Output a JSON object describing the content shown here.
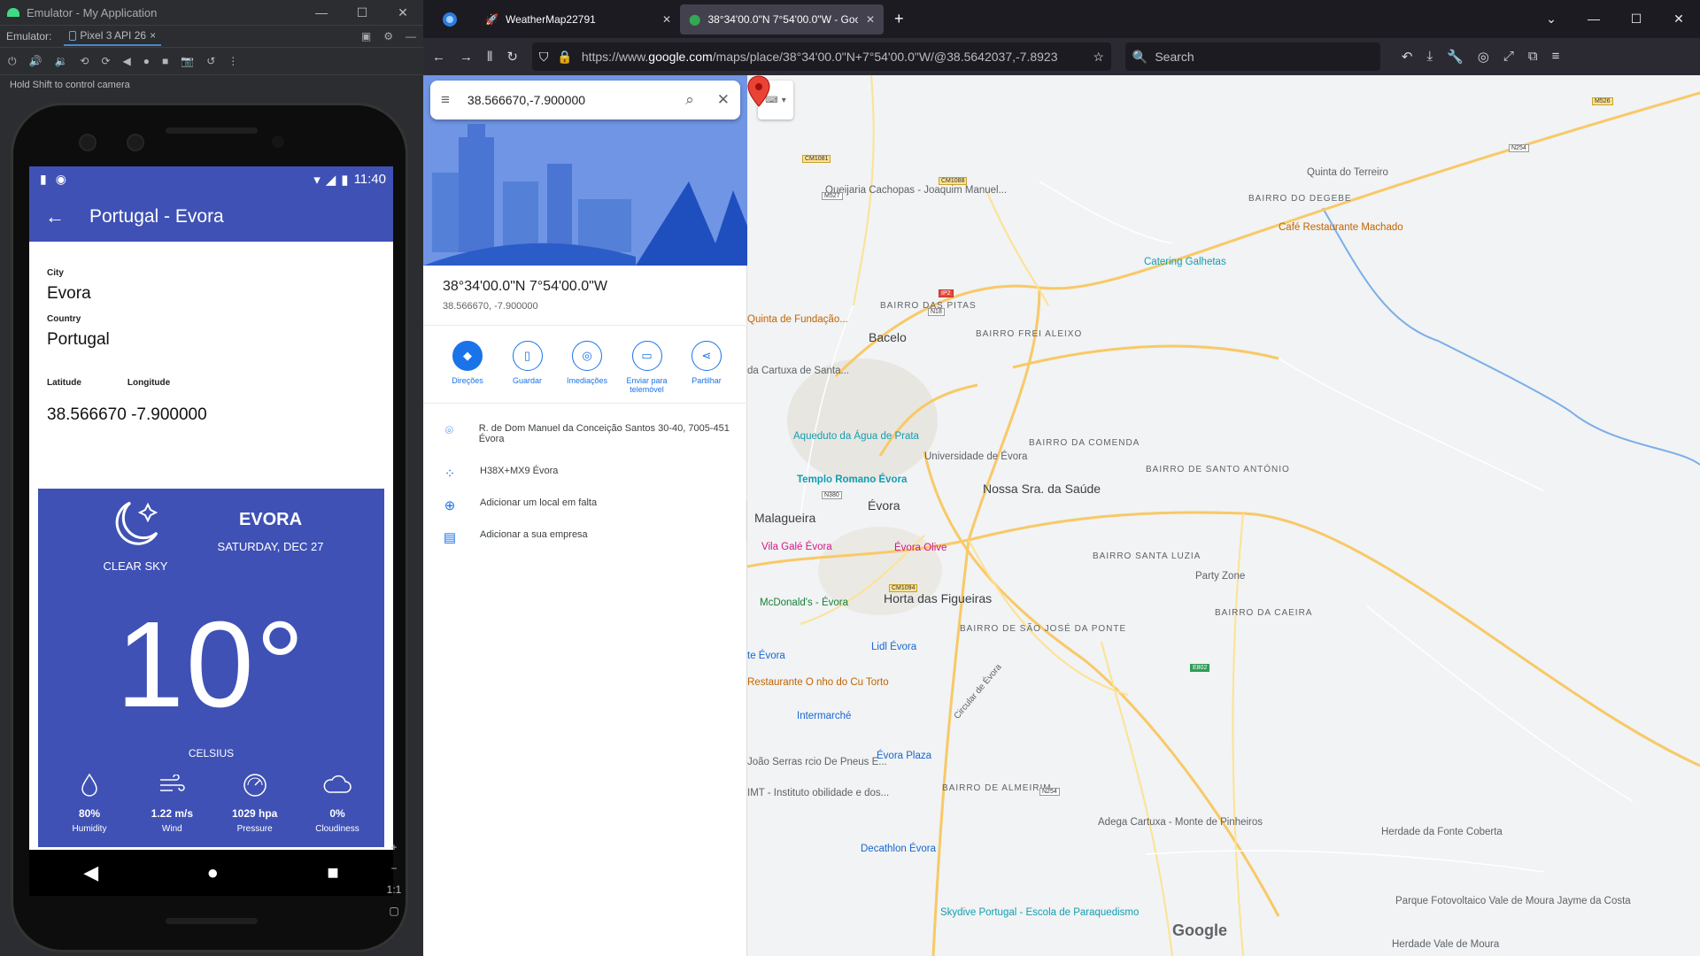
{
  "emulator": {
    "window_title": "Emulator - My Application",
    "tab_label": "Emulator:",
    "device": "Pixel 3 API 26",
    "hint": "Hold Shift to control camera",
    "side_controls": [
      "+",
      "−",
      "1:1",
      "▢"
    ]
  },
  "app": {
    "status_time": "11:40",
    "toolbar_title": "Portugal - Evora",
    "city_label": "City",
    "city": "Evora",
    "country_label": "Country",
    "country": "Portugal",
    "latitude_label": "Latitude",
    "longitude_label": "Longitude",
    "coords": "38.566670 -7.900000",
    "weather": {
      "condition": "CLEAR SKY",
      "city": "EVORA",
      "date": "SATURDAY, DEC 27",
      "temperature": "10°",
      "unit": "CELSIUS",
      "stats": [
        {
          "value": "80%",
          "label": "Humidity",
          "icon": "drop-icon"
        },
        {
          "value": "1.22 m/s",
          "label": "Wind",
          "icon": "wind-icon"
        },
        {
          "value": "1029 hpa",
          "label": "Pressure",
          "icon": "gauge-icon"
        },
        {
          "value": "0%",
          "label": "Cloudiness",
          "icon": "cloud-icon"
        }
      ]
    },
    "colors": {
      "primary": "#3f51b5"
    }
  },
  "browser": {
    "tabs": [
      {
        "title": "WeatherMap22791"
      },
      {
        "title": "38°34'00.0\"N 7°54'00.0\"W - Goo"
      }
    ],
    "url_prefix": "https://www.",
    "url_domain": "google.com",
    "url_rest": "/maps/place/38°34'00.0\"N+7°54'00.0\"W/@38.5642037,-7.8923",
    "search_placeholder": "Search"
  },
  "maps": {
    "search_query": "38.566670,-7.900000",
    "place_title": "38°34'00.0\"N 7°54'00.0\"W",
    "place_sub": "38.566670, -7.900000",
    "actions": [
      "Direções",
      "Guardar",
      "Imediações",
      "Enviar para telemóvel",
      "Partilhar"
    ],
    "rows": [
      "R. de Dom Manuel da Conceição Santos 30-40, 7005-451 Évora",
      "H38X+MX9 Évora",
      "Adicionar um local em falta",
      "Adicionar a sua empresa"
    ],
    "labels": {
      "quinta_terreiro": "Quinta do Terreiro",
      "bairro_degebe": "BAIRRO DO DEGEBE",
      "cafe": "Café Restaurante Machado",
      "catering": "Catering Galhetas",
      "queijaria": "Queijaria Cachopas - Joaquim Manuel...",
      "quinta_fundacao": "Quinta de Fundação...",
      "bacelo": "Bacelo",
      "bairro_pitas": "BAIRRO DAS PITAS",
      "bairro_frei": "BAIRRO FREI ALEIXO",
      "cartuxa": "da Cartuxa de Santa...",
      "aqueduto": "Aqueduto da Água de Prata",
      "universidade": "Universidade de Évora",
      "bairro_comenda": "BAIRRO DA COMENDA",
      "bairro_antonio": "BAIRRO DE SANTO ANTÓNIO",
      "templo": "Templo Romano Évora",
      "nossa_sra": "Nossa Sra. da Saúde",
      "malagueira": "Malagueira",
      "evora": "Évora",
      "vila_gale": "Vila Galé Évora",
      "evora_olive": "Évora Olive",
      "bairro_luzia": "BAIRRO SANTA LUZIA",
      "party_zone": "Party Zone",
      "mcdonalds": "McDonald's - Évora",
      "horta": "Horta das Figueiras",
      "bairro_caeira": "BAIRRO DA CAEIRA",
      "lidl": "Lidl Évora",
      "te_evora": "te Évora",
      "bairro_sao_jose": "BAIRRO DE SÃO JOSÉ DA PONTE",
      "restaurante_torto": "Restaurante O nho do Cu Torto",
      "intermarche": "Intermarché",
      "circular": "Circular de Évora",
      "evora_plaza": "Évora Plaza",
      "joao_serras": "João Serras rcio De Pneus E...",
      "imt": "IMT - Instituto obilidade e dos...",
      "bairro_almeirim": "BAIRRO DE ALMEIRIM",
      "adega": "Adega Cartuxa - Monte de Pinheiros",
      "herdade_fonte": "Herdade da Fonte Coberta",
      "decathlon": "Decathlon Évora",
      "skydive": "Skydive Portugal - Escola de Paraquedismo",
      "parque": "Parque Fotovoltaico Vale de Moura Jayme da Costa",
      "herdade_vale": "Herdade Vale de Moura",
      "google": "Google"
    },
    "road_shields": [
      "M526",
      "N254",
      "CM1081",
      "M527",
      "CM1088",
      "N18",
      "IP2",
      "N380",
      "CM1094",
      "E802",
      "N254"
    ]
  }
}
